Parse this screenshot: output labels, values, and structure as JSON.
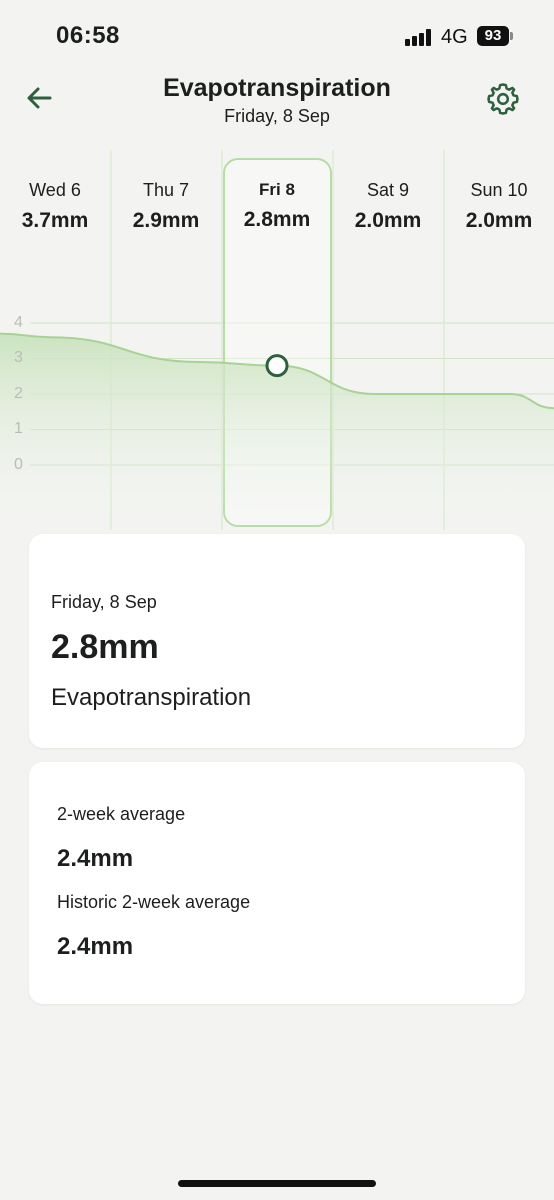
{
  "status_bar": {
    "time": "06:58",
    "network": "4G",
    "battery": "93"
  },
  "header": {
    "title": "Evapotranspiration",
    "subtitle": "Friday, 8 Sep"
  },
  "days": [
    {
      "name": "Wed 6",
      "value": "3.7mm",
      "selected": false
    },
    {
      "name": "Thu 7",
      "value": "2.9mm",
      "selected": false
    },
    {
      "name": "Fri 8",
      "value": "2.8mm",
      "selected": true
    },
    {
      "name": "Sat 9",
      "value": "2.0mm",
      "selected": false
    },
    {
      "name": "Sun 10",
      "value": "2.0mm",
      "selected": false
    }
  ],
  "chart_data": {
    "type": "area",
    "y_ticks": [
      "4",
      "3",
      "2",
      "1",
      "0"
    ],
    "ylim": [
      0,
      4
    ],
    "series": [
      {
        "values": [
          3.7,
          3.6,
          2.9,
          2.8,
          2.0,
          2.0,
          1.6
        ]
      }
    ],
    "selected_value": 2.8,
    "accent_color": "#8fc97a",
    "fill_color": "#cfe6c4",
    "marker_color": "#2e5f3f"
  },
  "summary": {
    "date": "Friday, 8 Sep",
    "value": "2.8mm",
    "label": "Evapotranspiration"
  },
  "averages": {
    "two_week_label": "2-week average",
    "two_week_value": "2.4mm",
    "historic_label": "Historic 2-week average",
    "historic_value": "2.4mm"
  }
}
